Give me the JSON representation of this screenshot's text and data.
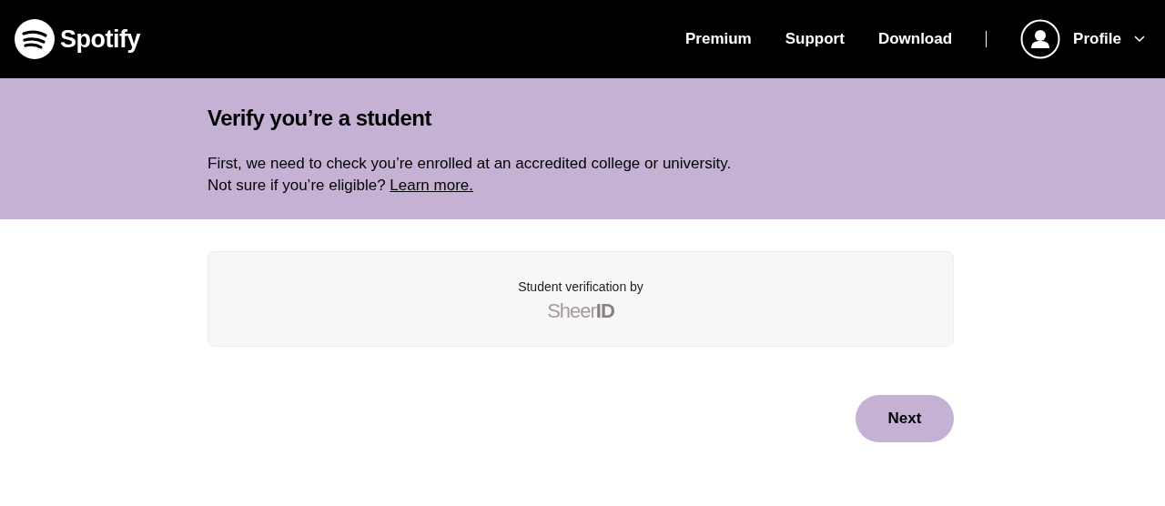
{
  "header": {
    "logo": "Spotify",
    "nav": [
      "Premium",
      "Support",
      "Download"
    ],
    "profile": "Profile"
  },
  "banner": {
    "title": "Verify you’re a student",
    "line1": "First, we need to check you’re enrolled at an accredited college or university.",
    "line2": "Not sure if you’re eligible?",
    "link": "Learn more."
  },
  "card": {
    "caption": "Student verification by",
    "logo_main": "Sheer",
    "logo_mark": "ID"
  },
  "buttons": [
    {
      "label": "Next"
    }
  ]
}
